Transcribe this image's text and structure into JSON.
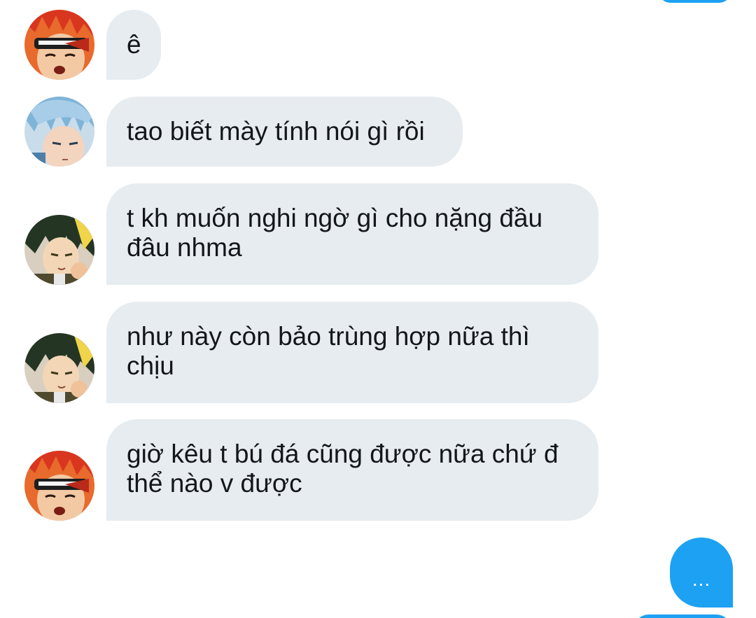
{
  "messages": [
    {
      "sender": "red-haired-user",
      "text": "ê"
    },
    {
      "sender": "blue-haired-user",
      "text": "tao biết mày tính nói gì rồi"
    },
    {
      "sender": "green-haired-user",
      "text": "t kh muốn nghi ngờ gì cho nặng đầu đâu nhma"
    },
    {
      "sender": "green-haired-user",
      "text": "như này còn bảo trùng hợp nữa thì chịu"
    },
    {
      "sender": "red-haired-user",
      "text": "giờ kêu t bú đá cũng được nữa chứ đ thể nào v được"
    }
  ],
  "typing_indicator": {
    "text": "..."
  },
  "colors": {
    "received_bubble": "#e6ecf0",
    "sent_bubble": "#1da1f2",
    "text": "#14171a"
  }
}
